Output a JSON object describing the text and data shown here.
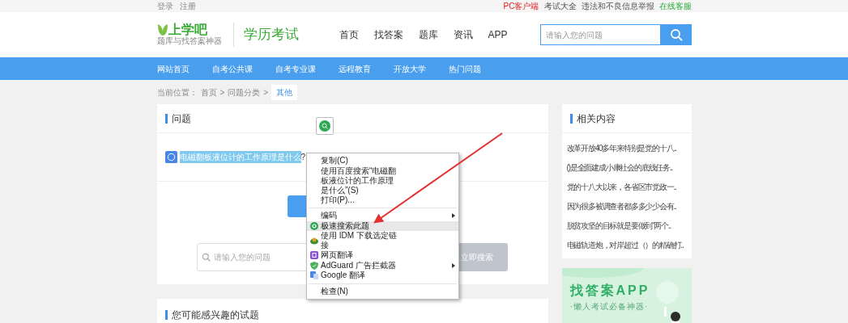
{
  "top_bar": {
    "left_links": [
      "登录",
      "注册"
    ],
    "right_links": [
      {
        "text": "PC客户端",
        "kind": "client"
      },
      {
        "text": "考试大全",
        "kind": "plain"
      },
      {
        "text": "违法和不良信息举报",
        "kind": "plain"
      },
      {
        "text": "在线客服",
        "kind": "service"
      }
    ]
  },
  "header": {
    "logo": {
      "name": "上学吧",
      "tagline": "题库与找答案神器"
    },
    "section": "学历考试",
    "nav": [
      "首页",
      "找答案",
      "题库",
      "资讯",
      "APP"
    ],
    "search": {
      "placeholder": "请输入您的问题"
    }
  },
  "nav_bar": [
    "网站首页",
    "自考公共课",
    "自考专业课",
    "远程教育",
    "开放大学",
    "热门问题"
  ],
  "breadcrumb": {
    "label": "当前位置：",
    "items": [
      "首页",
      "问题分类"
    ],
    "separator": ">",
    "current": "其他"
  },
  "question_card": {
    "title": "问题",
    "question": {
      "text": "电磁翻板液位计的工作原理是什么",
      "suffix": "?",
      "selected": true
    },
    "search": {
      "placeholder": "请输入您的问题",
      "button": "立即搜索",
      "disabled": true
    }
  },
  "related": {
    "title": "相关内容",
    "items": [
      "改革开放40多年来特别是党的十八..",
      "()是全面建成小康社会的底线任务..",
      "党的十八大以来，各省区市党政一..",
      "因为很多被调查者都多多少少会有..",
      "脱贫攻坚的目标就是要做到“两个..",
      "电磁轨道炮，对岸超过（）的精确打.."
    ]
  },
  "banner": {
    "title": "找答案APP",
    "subtitle": "·懒人考试必备神器·"
  },
  "interest_card": {
    "title": "您可能感兴趣的试题"
  },
  "context_menu": [
    {
      "kind": "item",
      "label": "复制(C)",
      "highlighted": false,
      "submenu": false
    },
    {
      "kind": "item",
      "label": "使用百度搜索“电磁翻板液位计的工作原理是什么”(S)",
      "highlighted": false,
      "submenu": false
    },
    {
      "kind": "item",
      "label": "打印(P)...",
      "highlighted": false,
      "submenu": false
    },
    {
      "kind": "separator"
    },
    {
      "kind": "item",
      "label": "编码",
      "highlighted": false,
      "submenu": true
    },
    {
      "kind": "icon_item",
      "label": "极速搜索此题",
      "highlighted": true,
      "submenu": false
    },
    {
      "kind": "icon_item",
      "label": "使用 IDM 下载选定链接",
      "highlighted": false,
      "submenu": false
    },
    {
      "kind": "icon_item",
      "label": "网页翻译",
      "highlighted": false,
      "submenu": false
    },
    {
      "kind": "icon_item",
      "label": "AdGuard 广告拦截器",
      "highlighted": false,
      "submenu": true
    },
    {
      "kind": "icon_item",
      "label": "Google 翻译",
      "highlighted": false,
      "submenu": false
    },
    {
      "kind": "separator"
    },
    {
      "kind": "item",
      "label": "检查(N)",
      "highlighted": false,
      "submenu": false
    }
  ]
}
